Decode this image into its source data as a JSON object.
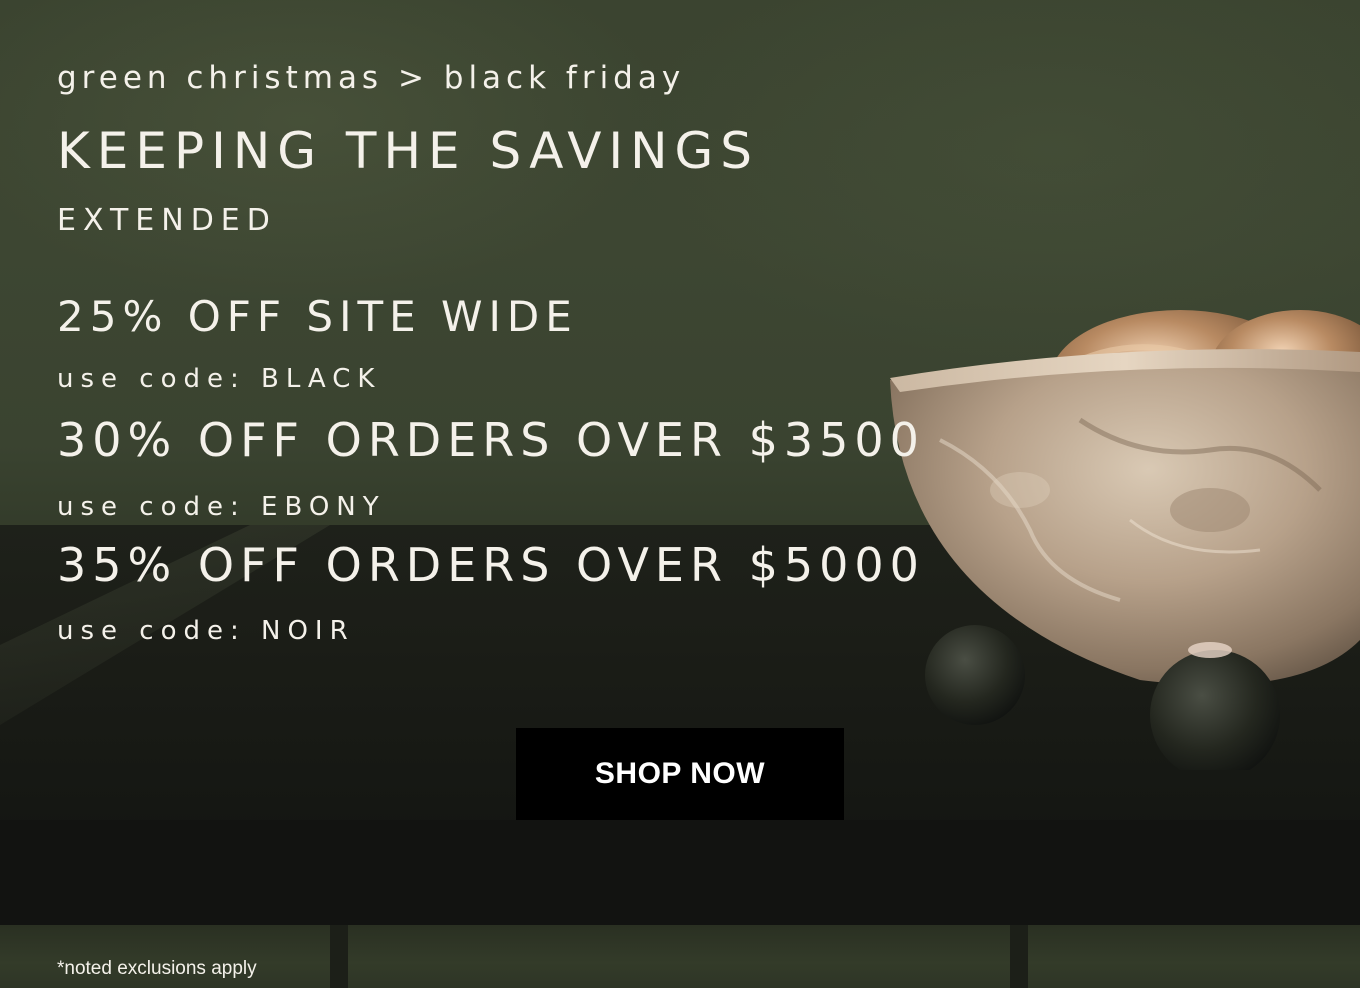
{
  "banner": {
    "breadcrumb": "green christmas > black friday",
    "headline": "KEEPING THE SAVINGS",
    "subhead": "EXTENDED",
    "offers": [
      {
        "title": "25% OFF SITE WIDE",
        "code": "use code: BLACK"
      },
      {
        "title": "30% OFF ORDERS OVER $3500",
        "code": "use code: EBONY"
      },
      {
        "title": "35% OFF ORDERS OVER $5000",
        "code": "use code: NOIR"
      }
    ],
    "cta_label": "SHOP NOW",
    "disclaimer": "*noted exclusions apply"
  },
  "colors": {
    "wall": "#3b4430",
    "table": "#151713",
    "text": "#f4f1ea",
    "button_bg": "#000000",
    "button_text": "#ffffff"
  },
  "icons": {
    "product_image": "stone-bowl-image"
  }
}
